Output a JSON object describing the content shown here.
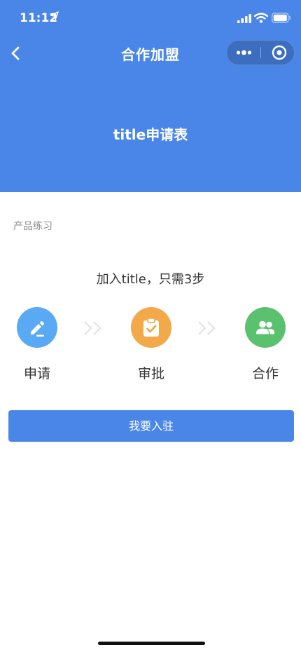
{
  "status_bar": {
    "time": "11:12"
  },
  "navbar": {
    "title": "合作加盟"
  },
  "banner": {
    "title": "title申请表"
  },
  "section": {
    "label": "产品练习"
  },
  "steps": {
    "heading": "加入title，只需3步",
    "items": [
      {
        "label": "申请",
        "icon": "edit-icon",
        "color": "#5aa9f5"
      },
      {
        "label": "审批",
        "icon": "clipboard-check-icon",
        "color": "#f2a94a"
      },
      {
        "label": "合作",
        "icon": "people-icon",
        "color": "#5ac26f"
      }
    ]
  },
  "actions": {
    "join_label": "我要入驻"
  },
  "colors": {
    "primary": "#4a86e8"
  }
}
